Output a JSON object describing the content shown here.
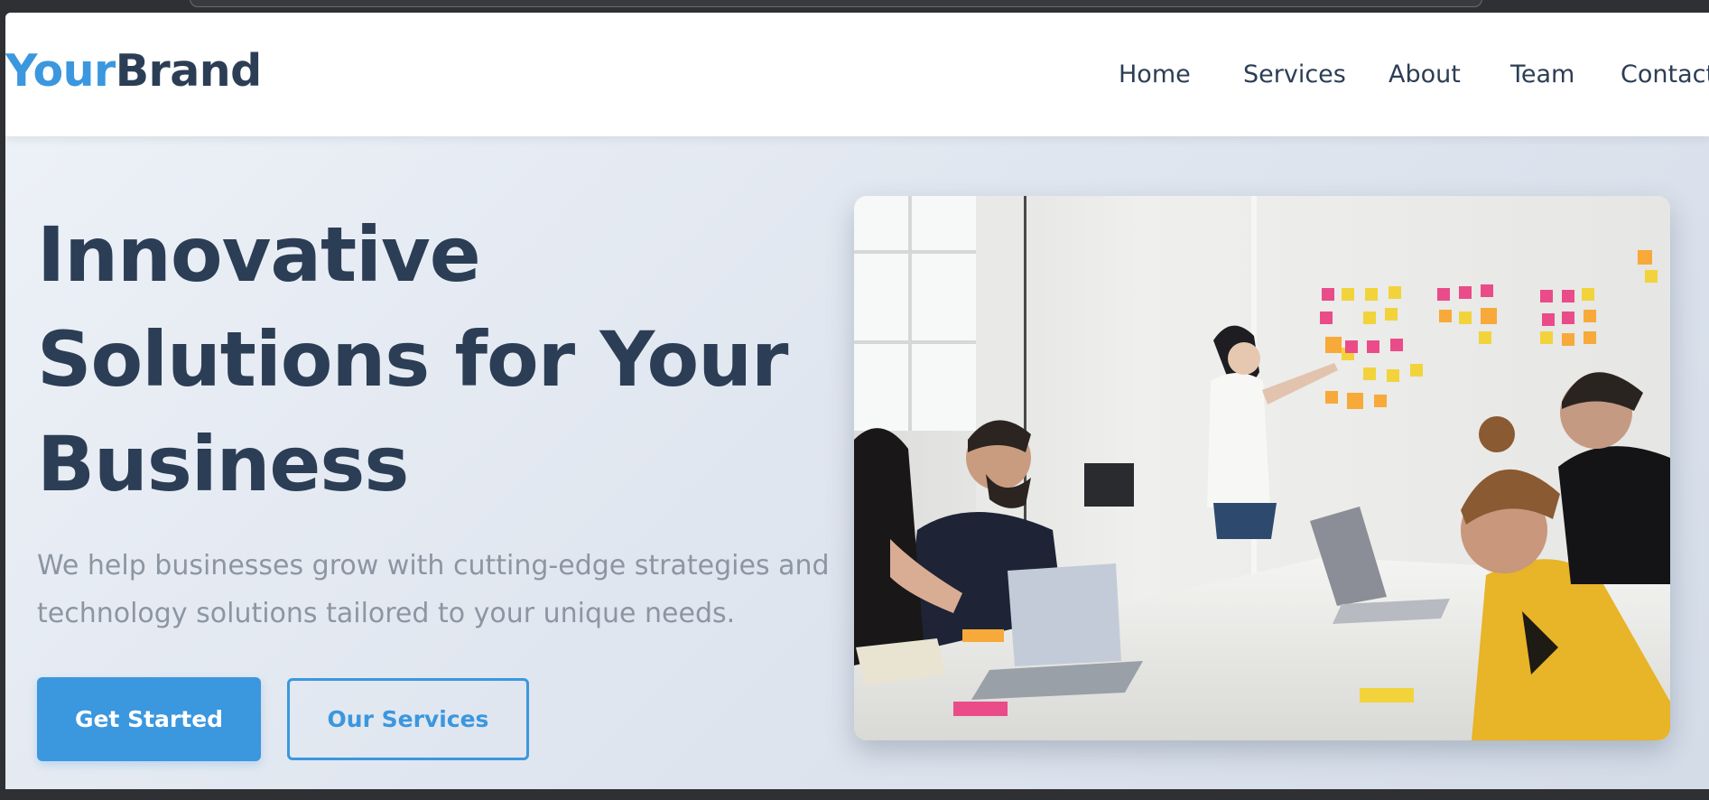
{
  "header": {
    "logo": {
      "part1": "Your",
      "part2": "Brand"
    },
    "nav": [
      {
        "label": "Home"
      },
      {
        "label": "Services"
      },
      {
        "label": "About"
      },
      {
        "label": "Team"
      },
      {
        "label": "Contact"
      }
    ]
  },
  "hero": {
    "title_lines": [
      "Innovative",
      "Solutions for Your",
      "Business"
    ],
    "subtitle_lines": [
      "We help businesses grow with cutting-edge strategies and",
      "technology solutions tailored to your unique needs."
    ],
    "primary_button": "Get Started",
    "secondary_button": "Our Services",
    "image_subject": "team meeting with sticky notes on a whiteboard"
  },
  "colors": {
    "accent": "#3b97de",
    "heading": "#2c3e55",
    "subtitle": "#8c96a3",
    "header_bg": "#ffffff"
  }
}
